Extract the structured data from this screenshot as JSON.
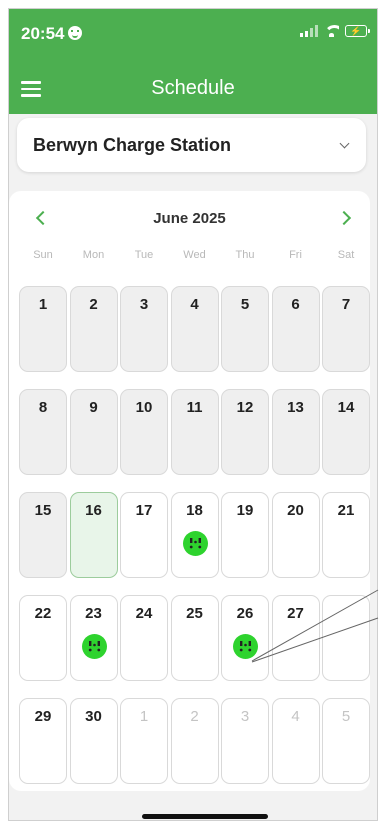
{
  "status": {
    "time": "20:54",
    "face_icon": "smiley-icon",
    "battery_icon": "charging-battery-icon"
  },
  "header": {
    "title": "Schedule",
    "menu_icon": "hamburger-menu-icon"
  },
  "station": {
    "selected": "Berwyn Charge Station",
    "icon": "chevron-down-icon"
  },
  "calendar": {
    "month_label": "June 2025",
    "prev_icon": "chevron-left-icon",
    "next_icon": "chevron-right-icon",
    "weekdays": [
      "Sun",
      "Mon",
      "Tue",
      "Wed",
      "Thu",
      "Fri",
      "Sat"
    ],
    "weeks": [
      [
        {
          "d": "1",
          "past": true
        },
        {
          "d": "2",
          "past": true
        },
        {
          "d": "3",
          "past": true
        },
        {
          "d": "4",
          "past": true
        },
        {
          "d": "5",
          "past": true
        },
        {
          "d": "6",
          "past": true
        },
        {
          "d": "7",
          "past": true
        }
      ],
      [
        {
          "d": "8",
          "past": true
        },
        {
          "d": "9",
          "past": true
        },
        {
          "d": "10",
          "past": true
        },
        {
          "d": "11",
          "past": true
        },
        {
          "d": "12",
          "past": true
        },
        {
          "d": "13",
          "past": true
        },
        {
          "d": "14",
          "past": true
        }
      ],
      [
        {
          "d": "15",
          "past": true
        },
        {
          "d": "16",
          "today": true
        },
        {
          "d": "17"
        },
        {
          "d": "18",
          "event": true
        },
        {
          "d": "19"
        },
        {
          "d": "20"
        },
        {
          "d": "21"
        }
      ],
      [
        {
          "d": "22"
        },
        {
          "d": "23",
          "event": true
        },
        {
          "d": "24"
        },
        {
          "d": "25"
        },
        {
          "d": "26",
          "event": true
        },
        {
          "d": "27"
        },
        {
          "d": ""
        }
      ],
      [
        {
          "d": "29"
        },
        {
          "d": "30"
        },
        {
          "d": "1",
          "other": true
        },
        {
          "d": "2",
          "other": true
        },
        {
          "d": "3",
          "other": true
        },
        {
          "d": "4",
          "other": true
        },
        {
          "d": "5",
          "other": true
        }
      ]
    ],
    "event_icon": "ev-charger-plug-icon",
    "accent": "#4caf50",
    "event_color": "#2ed32e"
  }
}
